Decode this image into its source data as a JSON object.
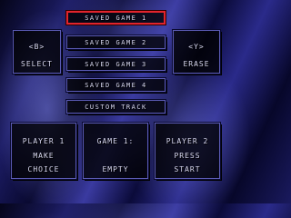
{
  "colors": {
    "selection": "#e0242c",
    "text": "#d8d8f0",
    "panel_border": "#5a5ab4"
  },
  "slots": [
    {
      "label": "SAVED GAME 1",
      "selected": true
    },
    {
      "label": "SAVED GAME 2",
      "selected": false
    },
    {
      "label": "SAVED GAME 3",
      "selected": false
    },
    {
      "label": "SAVED GAME 4",
      "selected": false
    },
    {
      "label": "CUSTOM TRACK",
      "selected": false
    }
  ],
  "select_box": {
    "button": "<B>",
    "action": "SELECT"
  },
  "erase_box": {
    "button": "<Y>",
    "action": "ERASE"
  },
  "player1_box": {
    "line1": "PLAYER 1",
    "line2": "MAKE",
    "line3": "CHOICE"
  },
  "game_box": {
    "line1": "GAME 1:",
    "line2": "EMPTY"
  },
  "player2_box": {
    "line1": "PLAYER 2",
    "line2": "PRESS",
    "line3": "START"
  }
}
